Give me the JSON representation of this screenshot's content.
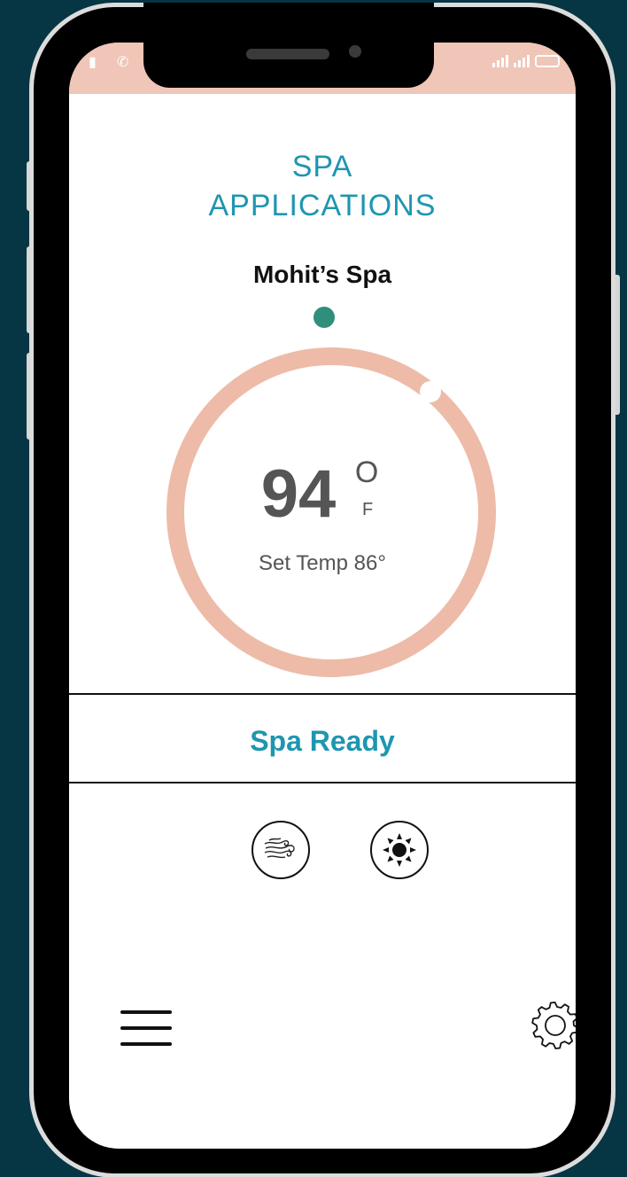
{
  "app": {
    "title": "SPA APPLICATIONS",
    "title_line1": "SPA",
    "title_line2": "APPLICATIONS"
  },
  "spa": {
    "name": "Mohit’s Spa",
    "online_indicator_color": "#2f8f7a"
  },
  "temperature": {
    "current": "94",
    "unit_degree": "O",
    "unit": "F",
    "set_temp_label": "Set Temp 86°",
    "ring_color": "#edbba8"
  },
  "status": {
    "text": "Spa Ready",
    "color": "#1e96b0"
  },
  "controls": [
    {
      "icon": "jets-icon",
      "label": "jets"
    },
    {
      "icon": "light-icon",
      "label": "light"
    }
  ],
  "nav": {
    "menu_icon": "hamburger-menu-icon",
    "settings_icon": "gear-icon"
  },
  "colors": {
    "accent": "#1e96b0",
    "statusbar": "#efc6b7",
    "background": "#063544"
  }
}
